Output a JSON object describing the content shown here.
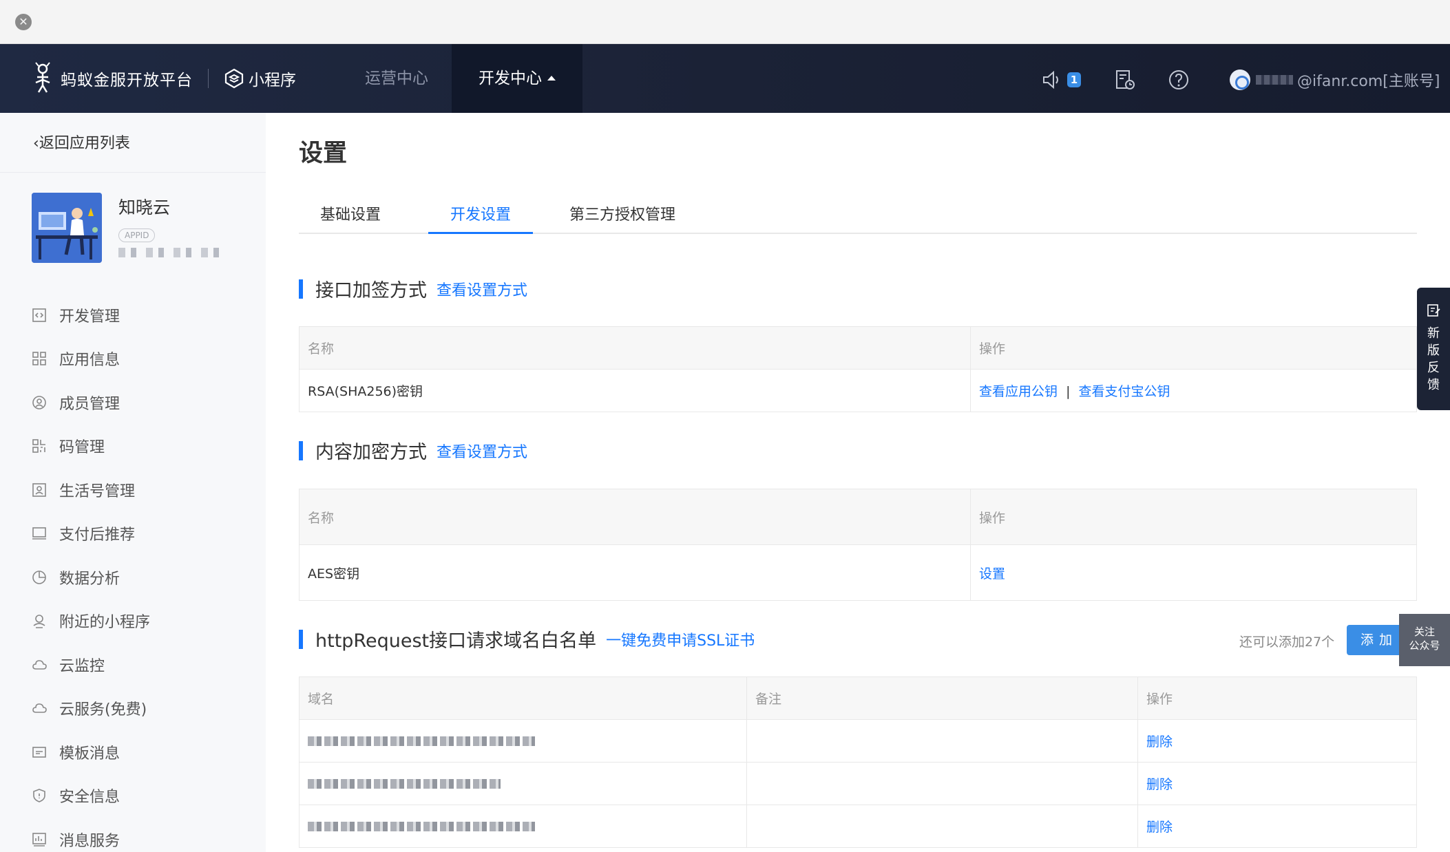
{
  "window": {
    "close_glyph": "✕"
  },
  "topnav": {
    "brand_name": "蚂蚁金服开放平台",
    "product_label": "小程序",
    "items": [
      {
        "label": "运营中心"
      },
      {
        "label": "开发中心"
      }
    ],
    "notification_count": "1",
    "account_suffix": "@ifanr.com[主账号]",
    "icons": [
      "logo-ant-icon",
      "mini-program-icon",
      "speaker-icon",
      "document-clock-icon",
      "help-icon",
      "user-avatar-icon"
    ]
  },
  "sidebar": {
    "back_label": "返回应用列表",
    "app": {
      "name": "知晓云",
      "appid_tag": "APPID"
    },
    "items": [
      {
        "label": "开发管理",
        "icon": "code-icon"
      },
      {
        "label": "应用信息",
        "icon": "apps-icon"
      },
      {
        "label": "成员管理",
        "icon": "member-icon"
      },
      {
        "label": "码管理",
        "icon": "qrcode-icon"
      },
      {
        "label": "生活号管理",
        "icon": "life-account-icon"
      },
      {
        "label": "支付后推荐",
        "icon": "monitor-icon"
      },
      {
        "label": "数据分析",
        "icon": "pie-chart-icon"
      },
      {
        "label": "附近的小程序",
        "icon": "nearby-icon"
      },
      {
        "label": "云监控",
        "icon": "cloud-icon"
      },
      {
        "label": "云服务(免费)",
        "icon": "cloud-service-icon"
      },
      {
        "label": "模板消息",
        "icon": "message-icon"
      },
      {
        "label": "安全信息",
        "icon": "shield-icon"
      },
      {
        "label": "消息服务",
        "icon": "chart-icon"
      }
    ]
  },
  "main": {
    "title": "设置",
    "tabs": [
      {
        "label": "基础设置"
      },
      {
        "label": "开发设置"
      },
      {
        "label": "第三方授权管理"
      }
    ],
    "sign_section": {
      "title": "接口加签方式",
      "link": "查看设置方式",
      "headers": [
        "名称",
        "操作"
      ],
      "row": {
        "name": "RSA(SHA256)密钥",
        "action1": "查看应用公钥",
        "separator": "|",
        "action2": "查看支付宝公钥"
      }
    },
    "encrypt_section": {
      "title": "内容加密方式",
      "link": "查看设置方式",
      "headers": [
        "名称",
        "操作"
      ],
      "row": {
        "name": "AES密钥",
        "action": "设置"
      }
    },
    "whitelist_section": {
      "title": "httpRequest接口请求域名白名单",
      "link": "一键免费申请SSL证书",
      "quota": "还可以添加27个",
      "add_label": "添加",
      "headers": [
        "域名",
        "备注",
        "操作"
      ],
      "rows": [
        {
          "action": "删除"
        },
        {
          "action": "删除"
        },
        {
          "action": "删除"
        }
      ]
    }
  },
  "floating": {
    "feedback_label": "新版反馈",
    "follow_label_1": "关注",
    "follow_label_2": "公众号"
  },
  "colors": {
    "accent": "#1677ff",
    "nav_bg": "#1b2236",
    "sidebar_bg": "#f7f8fa"
  }
}
